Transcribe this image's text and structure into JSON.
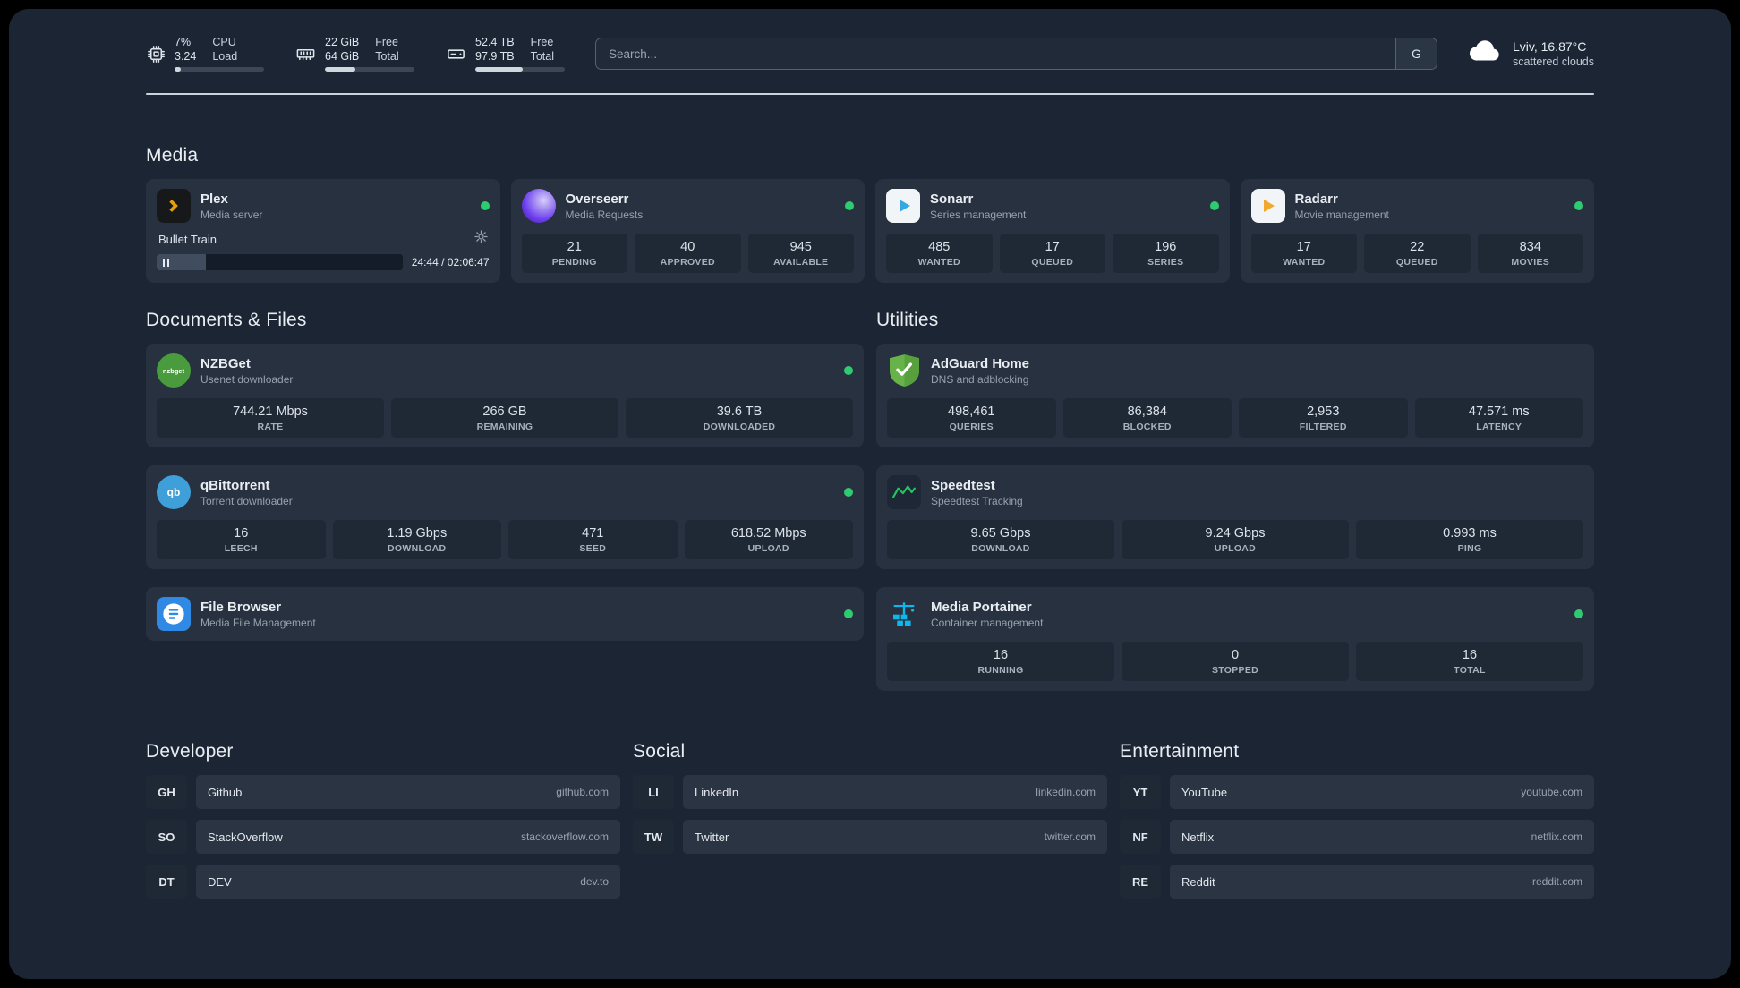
{
  "colors": {
    "status_online": "#2ecc71",
    "accent_blue": "#35a8e0",
    "accent_amber": "#e5a00d"
  },
  "topbar": {
    "cpu": {
      "value_top": "7%",
      "value_bottom": "3.24",
      "label_top": "CPU",
      "label_bottom": "Load",
      "percent": 7
    },
    "memory": {
      "value_top": "22 GiB",
      "value_bottom": "64 GiB",
      "label_top": "Free",
      "label_bottom": "Total",
      "percent": 34
    },
    "disk": {
      "value_top": "52.4 TB",
      "value_bottom": "97.9 TB",
      "label_top": "Free",
      "label_bottom": "Total",
      "percent": 53
    },
    "search": {
      "placeholder": "Search...",
      "button_label": "G"
    },
    "weather": {
      "location": "Lviv, 16.87°C",
      "condition": "scattered clouds"
    }
  },
  "media": {
    "heading": "Media",
    "plex": {
      "title": "Plex",
      "subtitle": "Media server",
      "now_playing": "Bullet Train",
      "time": "24:44 / 02:06:47",
      "progress_percent": 20
    },
    "overseerr": {
      "title": "Overseerr",
      "subtitle": "Media Requests",
      "stats": [
        {
          "value": "21",
          "label": "PENDING"
        },
        {
          "value": "40",
          "label": "APPROVED"
        },
        {
          "value": "945",
          "label": "AVAILABLE"
        }
      ]
    },
    "sonarr": {
      "title": "Sonarr",
      "subtitle": "Series management",
      "stats": [
        {
          "value": "485",
          "label": "WANTED"
        },
        {
          "value": "17",
          "label": "QUEUED"
        },
        {
          "value": "196",
          "label": "SERIES"
        }
      ]
    },
    "radarr": {
      "title": "Radarr",
      "subtitle": "Movie management",
      "stats": [
        {
          "value": "17",
          "label": "WANTED"
        },
        {
          "value": "22",
          "label": "QUEUED"
        },
        {
          "value": "834",
          "label": "MOVIES"
        }
      ]
    }
  },
  "documents": {
    "heading": "Documents & Files",
    "nzbget": {
      "title": "NZBGet",
      "subtitle": "Usenet downloader",
      "stats": [
        {
          "value": "744.21 Mbps",
          "label": "RATE"
        },
        {
          "value": "266 GB",
          "label": "REMAINING"
        },
        {
          "value": "39.6 TB",
          "label": "DOWNLOADED"
        }
      ]
    },
    "qbittorrent": {
      "title": "qBittorrent",
      "subtitle": "Torrent downloader",
      "stats": [
        {
          "value": "16",
          "label": "LEECH"
        },
        {
          "value": "1.19 Gbps",
          "label": "DOWNLOAD"
        },
        {
          "value": "471",
          "label": "SEED"
        },
        {
          "value": "618.52 Mbps",
          "label": "UPLOAD"
        }
      ]
    },
    "filebrowser": {
      "title": "File Browser",
      "subtitle": "Media File Management"
    }
  },
  "utilities": {
    "heading": "Utilities",
    "adguard": {
      "title": "AdGuard Home",
      "subtitle": "DNS and adblocking",
      "stats": [
        {
          "value": "498,461",
          "label": "QUERIES"
        },
        {
          "value": "86,384",
          "label": "BLOCKED"
        },
        {
          "value": "2,953",
          "label": "FILTERED"
        },
        {
          "value": "47.571 ms",
          "label": "LATENCY"
        }
      ]
    },
    "speedtest": {
      "title": "Speedtest",
      "subtitle": "Speedtest Tracking",
      "stats": [
        {
          "value": "9.65 Gbps",
          "label": "DOWNLOAD"
        },
        {
          "value": "9.24 Gbps",
          "label": "UPLOAD"
        },
        {
          "value": "0.993 ms",
          "label": "PING"
        }
      ]
    },
    "portainer": {
      "title": "Media Portainer",
      "subtitle": "Container management",
      "stats": [
        {
          "value": "16",
          "label": "RUNNING"
        },
        {
          "value": "0",
          "label": "STOPPED"
        },
        {
          "value": "16",
          "label": "TOTAL"
        }
      ]
    }
  },
  "bookmarks": {
    "developer": {
      "heading": "Developer",
      "items": [
        {
          "abbr": "GH",
          "name": "Github",
          "domain": "github.com"
        },
        {
          "abbr": "SO",
          "name": "StackOverflow",
          "domain": "stackoverflow.com"
        },
        {
          "abbr": "DT",
          "name": "DEV",
          "domain": "dev.to"
        }
      ]
    },
    "social": {
      "heading": "Social",
      "items": [
        {
          "abbr": "LI",
          "name": "LinkedIn",
          "domain": "linkedin.com"
        },
        {
          "abbr": "TW",
          "name": "Twitter",
          "domain": "twitter.com"
        }
      ]
    },
    "entertainment": {
      "heading": "Entertainment",
      "items": [
        {
          "abbr": "YT",
          "name": "YouTube",
          "domain": "youtube.com"
        },
        {
          "abbr": "NF",
          "name": "Netflix",
          "domain": "netflix.com"
        },
        {
          "abbr": "RE",
          "name": "Reddit",
          "domain": "reddit.com"
        }
      ]
    }
  },
  "icons": {
    "nzbget_label": "nzbget",
    "qbittorrent_label": "qb"
  }
}
